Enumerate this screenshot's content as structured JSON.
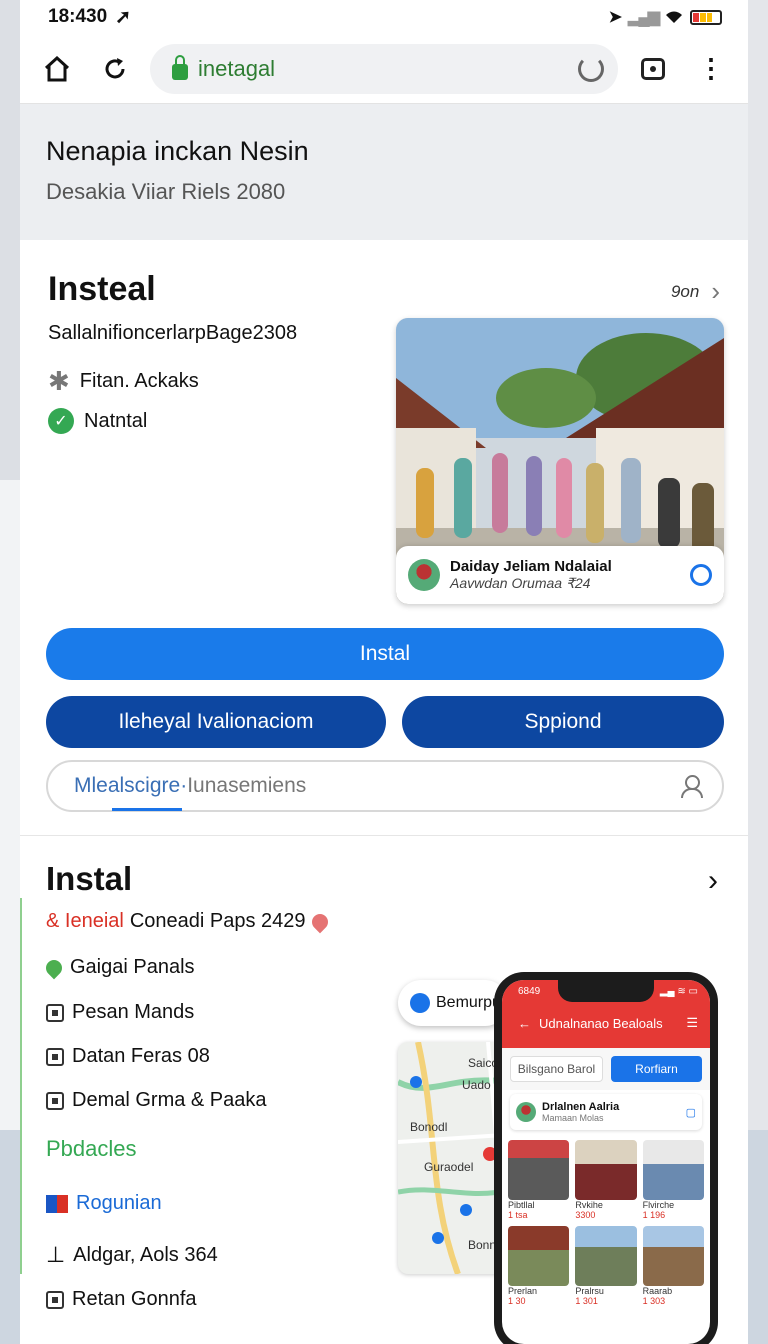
{
  "status_bar": {
    "time": "18:430",
    "nav_arrow": "➚"
  },
  "browser": {
    "url": "inetagal"
  },
  "banner": {
    "title": "Nenapia inckan Nesin",
    "subtitle": "Desakia Viiar Riels 2080"
  },
  "section1": {
    "title": "Insteal",
    "more_label": "9on",
    "subtitle": "SallalnifioncerlarpBage2308",
    "features": [
      {
        "label": "Fitan. Ackaks",
        "icon": "asterisk-icon"
      },
      {
        "label": "Natntal",
        "icon": "check-circle-icon"
      }
    ],
    "card": {
      "title": "Daiday Jeliam Ndalaial",
      "subtitle": "Aavwdan Orumaa ₹24"
    },
    "primary_button": "Instal",
    "secondary_button_1": "Ileheyal Ivalionaciom",
    "secondary_button_2": "Sppiond",
    "search": {
      "active_text": "Mlealscigre·",
      "rest_text": " Iunasemiens"
    }
  },
  "section2": {
    "title": "Instal",
    "highlight_prefix": "& Ieneial",
    "highlight_rest": " Coneadi Paps 2429",
    "items": [
      {
        "label": "Gaigai Panals",
        "icon": "map-pin-icon"
      },
      {
        "label": "Pesan Mands",
        "icon": "square-icon"
      },
      {
        "label": "Datan Feras 08",
        "icon": "square-icon"
      },
      {
        "label": "Demal Grma & Paaka",
        "icon": "square-icon"
      }
    ],
    "green_heading": "Pbdacles",
    "blue_item": "Rogunian",
    "list2": [
      {
        "label": "Aldgar, Aols 364"
      },
      {
        "label": "Retan Gonnfa"
      }
    ],
    "float_pill": "Bemurpu",
    "map_labels": [
      "Saico",
      "Uado",
      "Bonodl",
      "Guraodel",
      "Bonn"
    ]
  },
  "device_app": {
    "time": "6849",
    "title": "Udnalnanao Bealoals",
    "tab1": "Bilsgano Barol",
    "tab2": "Rorfiarn",
    "row_title": "Drlalnen Aalria",
    "row_sub": "Mamaan Molas",
    "thumbs": [
      {
        "name": "Pibtllal",
        "price": "1 tsa"
      },
      {
        "name": "Rvkihe",
        "price": "3300"
      },
      {
        "name": "Flvirche",
        "price": "1 196"
      },
      {
        "name": "Prerlan",
        "price": "1 30"
      },
      {
        "name": "Pralrsu",
        "price": "1 301"
      },
      {
        "name": "Raarab",
        "price": "1 303"
      }
    ]
  }
}
